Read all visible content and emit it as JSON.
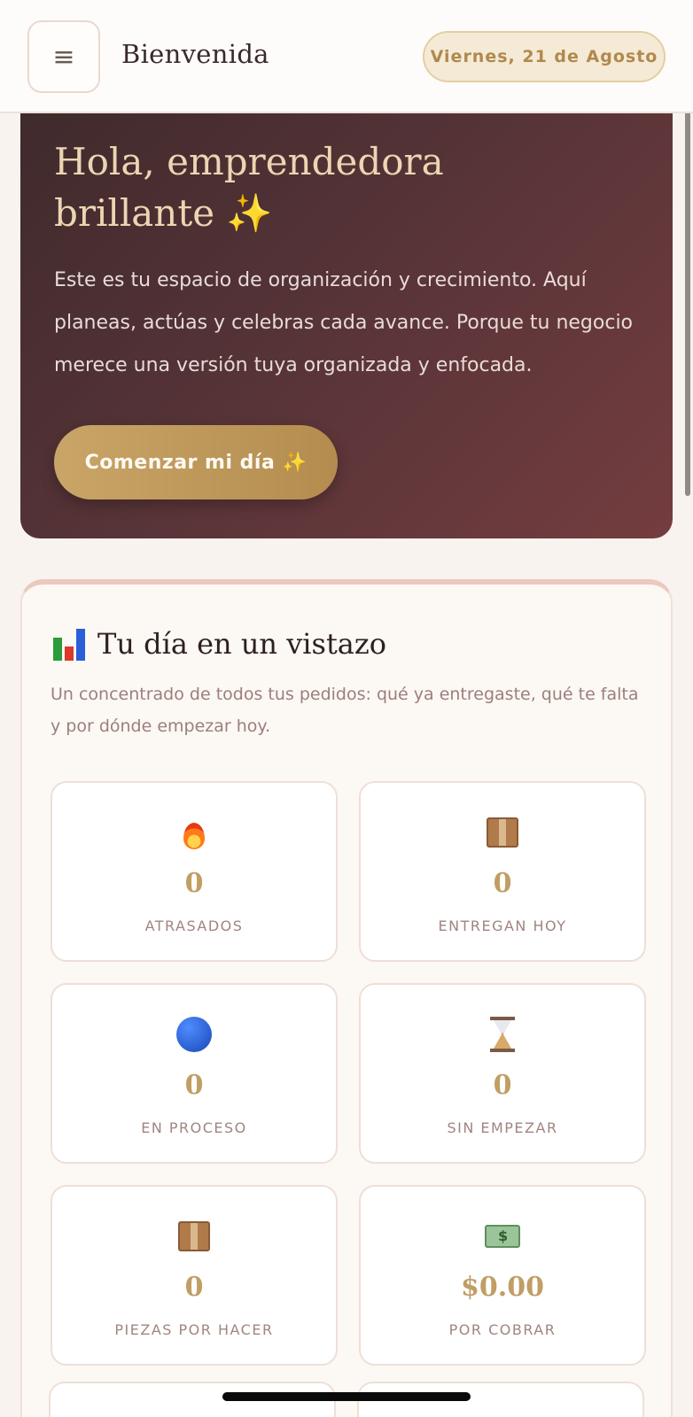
{
  "header": {
    "menu_icon": "menu-icon",
    "title": "Bienvenida",
    "date": "Viernes, 21 de Agosto"
  },
  "hero": {
    "title_line1": "Hola, emprendedora",
    "title_line2": "brillante ✨",
    "text": "Este es tu espacio de organización y crecimiento. Aquí planeas, actúas y celebras cada avance. Porque tu negocio merece una versión tuya organizada y enfocada.",
    "button_label": "Comenzar mi día ✨"
  },
  "summary": {
    "title": "Tu día en un vistazo",
    "subtitle": "Un concentrado de todos tus pedidos: qué ya entregaste, qué te falta y por dónde empezar hoy.",
    "tiles": [
      {
        "icon": "fire-icon",
        "value": "0",
        "label": "ATRASADOS"
      },
      {
        "icon": "package-icon",
        "value": "0",
        "label": "ENTREGAN HOY"
      },
      {
        "icon": "blue-circle-icon",
        "value": "0",
        "label": "EN PROCESO"
      },
      {
        "icon": "hourglass-icon",
        "value": "0",
        "label": "SIN EMPEZAR"
      },
      {
        "icon": "package-icon",
        "value": "0",
        "label": "PIEZAS POR HACER"
      },
      {
        "icon": "money-icon",
        "value": "$0.00",
        "label": "POR COBRAR"
      }
    ]
  },
  "colors": {
    "accent_gold": "#c09e64",
    "hero_start": "#3f2a2c",
    "hero_end": "#743d3f"
  }
}
